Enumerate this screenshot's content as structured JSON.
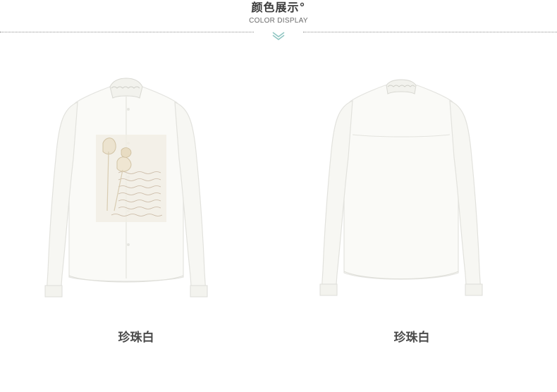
{
  "header": {
    "title": "颜色展示°",
    "subtitle": "COLOR DISPLAY",
    "accent_color": "#8fc6c2"
  },
  "products": [
    {
      "view": "front",
      "caption": "珍珠白",
      "icon": "shirt-front-image"
    },
    {
      "view": "back",
      "caption": "珍珠白",
      "icon": "shirt-back-image"
    }
  ]
}
